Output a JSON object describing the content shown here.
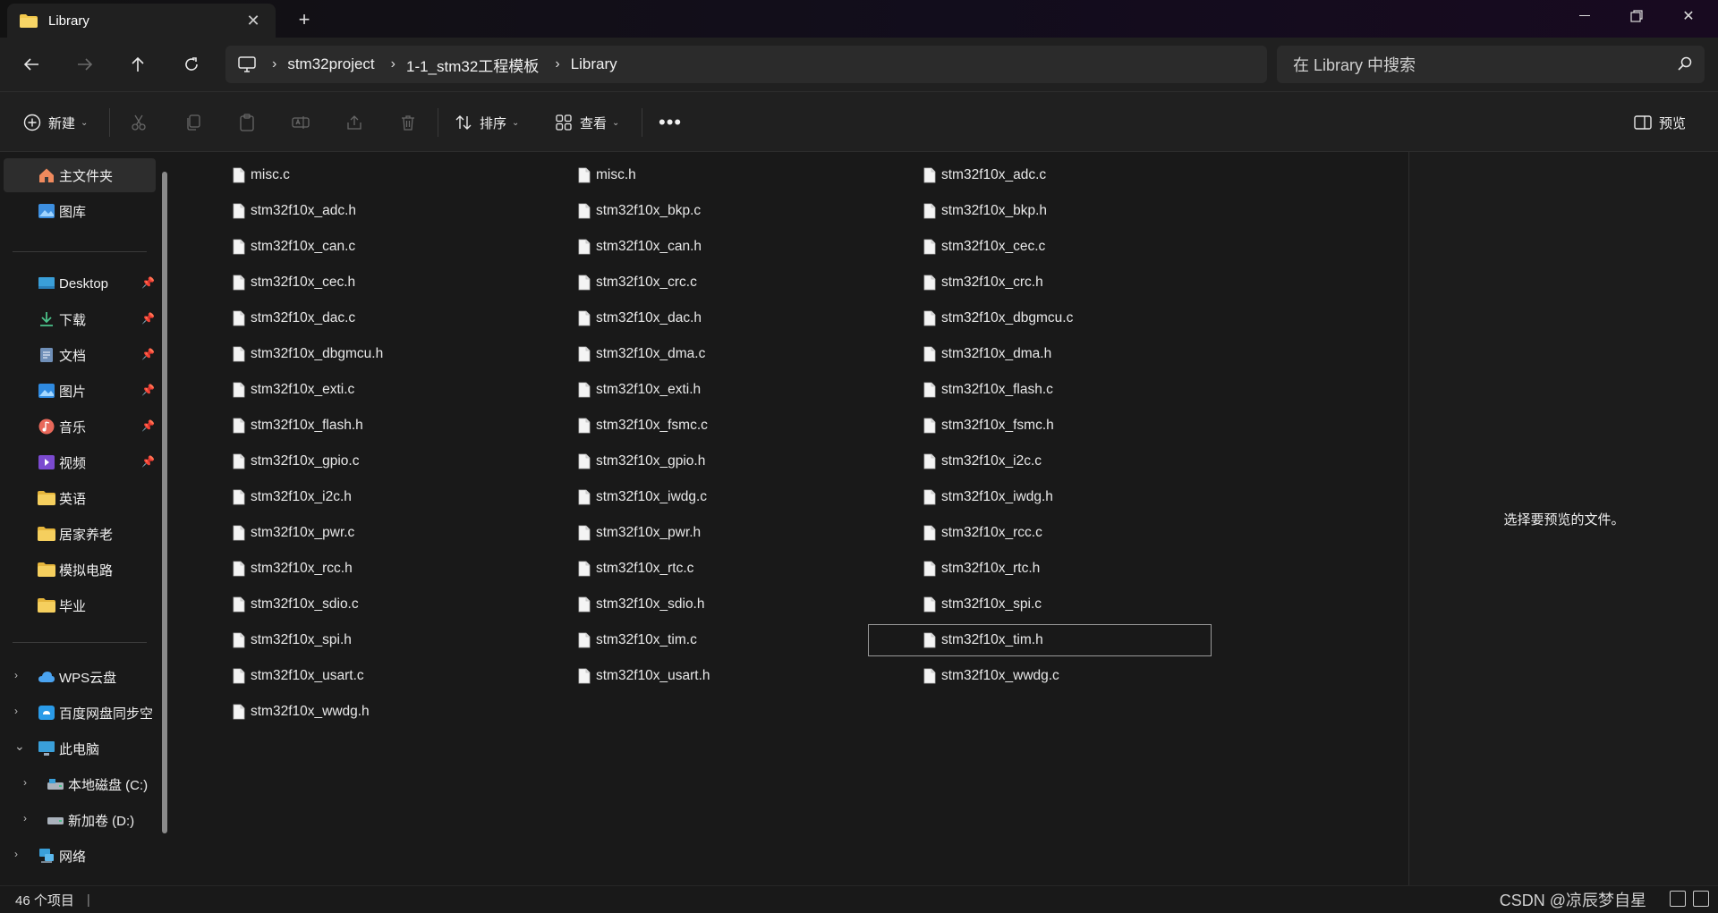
{
  "window": {
    "tab_title": "Library",
    "icons": [
      "folder-icon",
      "close-icon",
      "add-tab-icon",
      "minimize-icon",
      "restore-icon",
      "close-window-icon"
    ]
  },
  "address": {
    "crumbs": [
      "stm32project",
      "1-1_stm32工程模板",
      "Library"
    ],
    "search_placeholder": "在 Library 中搜索"
  },
  "toolbar": {
    "new_label": "新建",
    "sort_label": "排序",
    "view_label": "查看",
    "preview_label": "预览"
  },
  "sidebar": {
    "items": [
      {
        "label": "主文件夹",
        "icon": "home-icon"
      },
      {
        "label": "图库",
        "icon": "gallery-icon"
      },
      {
        "label": "Desktop",
        "icon": "desktop-icon",
        "pinned": true
      },
      {
        "label": "下载",
        "icon": "download-icon",
        "pinned": true
      },
      {
        "label": "文档",
        "icon": "document-icon",
        "pinned": true
      },
      {
        "label": "图片",
        "icon": "pictures-icon",
        "pinned": true
      },
      {
        "label": "音乐",
        "icon": "music-icon",
        "pinned": true
      },
      {
        "label": "视频",
        "icon": "video-icon",
        "pinned": true
      },
      {
        "label": "英语",
        "icon": "folder-icon"
      },
      {
        "label": "居家养老",
        "icon": "folder-icon"
      },
      {
        "label": "模拟电路",
        "icon": "folder-icon"
      },
      {
        "label": "毕业",
        "icon": "folder-icon"
      },
      {
        "label": "WPS云盘",
        "icon": "cloud-icon"
      },
      {
        "label": "百度网盘同步空",
        "icon": "baidu-icon"
      },
      {
        "label": "此电脑",
        "icon": "computer-icon"
      },
      {
        "label": "本地磁盘 (C:)",
        "icon": "drive-icon"
      },
      {
        "label": "新加卷 (D:)",
        "icon": "drive-icon"
      },
      {
        "label": "网络",
        "icon": "network-icon"
      }
    ]
  },
  "files": [
    "misc.c",
    "misc.h",
    "stm32f10x_adc.c",
    "stm32f10x_adc.h",
    "stm32f10x_bkp.c",
    "stm32f10x_bkp.h",
    "stm32f10x_can.c",
    "stm32f10x_can.h",
    "stm32f10x_cec.c",
    "stm32f10x_cec.h",
    "stm32f10x_crc.c",
    "stm32f10x_crc.h",
    "stm32f10x_dac.c",
    "stm32f10x_dac.h",
    "stm32f10x_dbgmcu.c",
    "stm32f10x_dbgmcu.h",
    "stm32f10x_dma.c",
    "stm32f10x_dma.h",
    "stm32f10x_exti.c",
    "stm32f10x_exti.h",
    "stm32f10x_flash.c",
    "stm32f10x_flash.h",
    "stm32f10x_fsmc.c",
    "stm32f10x_fsmc.h",
    "stm32f10x_gpio.c",
    "stm32f10x_gpio.h",
    "stm32f10x_i2c.c",
    "stm32f10x_i2c.h",
    "stm32f10x_iwdg.c",
    "stm32f10x_iwdg.h",
    "stm32f10x_pwr.c",
    "stm32f10x_pwr.h",
    "stm32f10x_rcc.c",
    "stm32f10x_rcc.h",
    "stm32f10x_rtc.c",
    "stm32f10x_rtc.h",
    "stm32f10x_sdio.c",
    "stm32f10x_sdio.h",
    "stm32f10x_spi.c",
    "stm32f10x_spi.h",
    "stm32f10x_tim.c",
    "stm32f10x_tim.h",
    "stm32f10x_usart.c",
    "stm32f10x_usart.h",
    "stm32f10x_wwdg.c",
    "stm32f10x_wwdg.h"
  ],
  "selected_file": "stm32f10x_tim.h",
  "preview": {
    "message": "选择要预览的文件。"
  },
  "status": {
    "count": "46 个项目"
  },
  "watermark": "CSDN @凉辰梦自星",
  "colors": {
    "folder": "#f2c84b",
    "accent": "#4aa3f0"
  }
}
